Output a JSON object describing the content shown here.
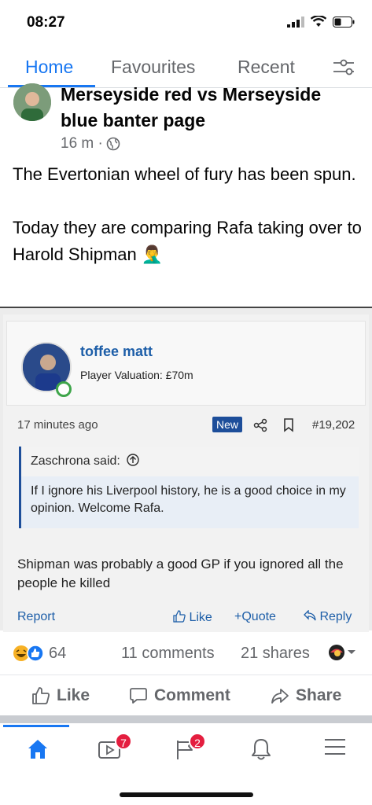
{
  "status": {
    "time": "08:27"
  },
  "tabs": [
    {
      "label": "Home",
      "active": true
    },
    {
      "label": "Favourites",
      "active": false
    },
    {
      "label": "Recent",
      "active": false
    }
  ],
  "post": {
    "author": "Merseyside red vs Merseyside blue banter page",
    "time": "16 m ·",
    "paragraphs": [
      "The Evertonian wheel of fury has been spun.",
      "Today they are comparing Rafa taking over to Harold Shipman 🤦‍♂️"
    ]
  },
  "forum": {
    "username": "toffee matt",
    "valuation": "Player Valuation: £70m",
    "time": "17 minutes ago",
    "new_badge": "New",
    "post_number": "#19,202",
    "quote_head": "Zaschrona said:",
    "quote_body": "If I ignore his Liverpool history, he is a good choice in my opinion. Welcome Rafa.",
    "body": "Shipman was probably a good GP if you ignored all the people he killed",
    "actions": {
      "report": "Report",
      "like": "Like",
      "quote": "+Quote",
      "reply": "Reply"
    }
  },
  "engagement": {
    "reaction_count": "64",
    "comments": "11 comments",
    "shares": "21 shares"
  },
  "actions": {
    "like": "Like",
    "comment": "Comment",
    "share": "Share"
  },
  "bottom_nav": {
    "video_badge": "7",
    "pages_badge": "2"
  },
  "colors": {
    "accent": "#1877f2",
    "badge": "#e41e3f",
    "forum_link": "#1d5ea8"
  }
}
